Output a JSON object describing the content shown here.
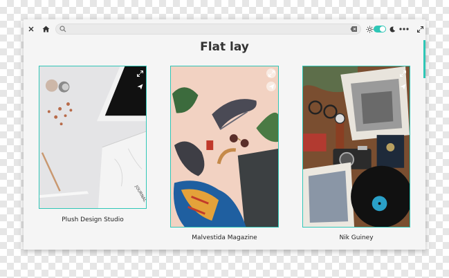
{
  "browser": {
    "url_value": "",
    "icons": [
      "close-icon",
      "home-icon",
      "search-icon",
      "clear-icon",
      "sun-icon",
      "moon-icon",
      "more-icon",
      "fullscreen-icon"
    ]
  },
  "page": {
    "title": "Flat lay"
  },
  "cards": [
    {
      "caption": "Plush Design Studio"
    },
    {
      "caption": "Malvestida Magazine"
    },
    {
      "caption": "Nik Guiney"
    }
  ],
  "colors": {
    "accent": "#2ec6b6",
    "window_bg": "#f5f5f5",
    "text": "#333333"
  }
}
